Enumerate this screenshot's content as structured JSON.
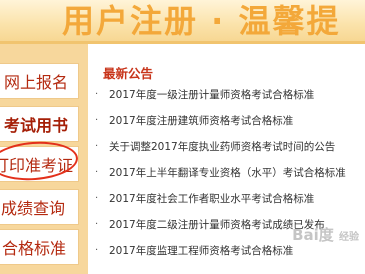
{
  "banner": {
    "title": "用户注册 · 温馨提"
  },
  "sidebar": {
    "items": [
      {
        "label": "网上报名"
      },
      {
        "label": "考试用书"
      },
      {
        "label": "打印准考证"
      },
      {
        "label": "成绩查询"
      },
      {
        "label": "合格标准"
      }
    ]
  },
  "news": {
    "title": "最新公告",
    "items": [
      "2017年度一级注册计量师资格考试合格标准",
      "2017年度注册建筑师资格考试合格标准",
      "关于调整2017年度执业药师资格考试时间的公告",
      "2017年上半年翻译专业资格（水平）考试合格标准",
      "2017年度社会工作者职业水平考试合格标准",
      "2017年度二级注册计量师资格考试成绩已发布",
      "2017年度监理工程师资格考试合格标准"
    ]
  },
  "watermark": {
    "text": "Bai度",
    "sub": "经验"
  }
}
